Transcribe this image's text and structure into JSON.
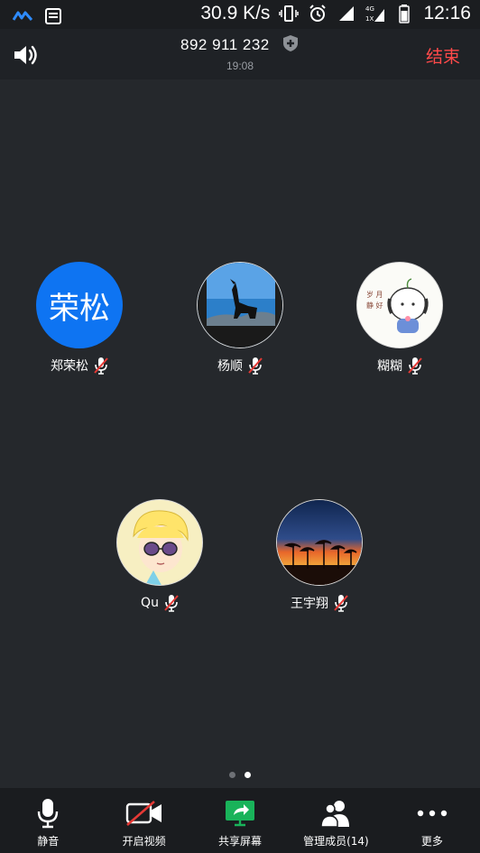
{
  "status_bar": {
    "speed": "30.9 K/s",
    "time": "12:16"
  },
  "header": {
    "meeting_id": "892 911 232",
    "duration": "19:08",
    "end_label": "结束"
  },
  "participants": [
    {
      "name": "郑荣松",
      "avatar_text": "荣松",
      "avatar_color": "#0e74f2",
      "muted": true
    },
    {
      "name": "杨顺",
      "avatar": "photo-dog-silhouette",
      "muted": true
    },
    {
      "name": "糊糊",
      "avatar": "illustration-cartoon",
      "muted": true
    },
    {
      "name": "Qu",
      "avatar": "illustration-anime-boy",
      "muted": true
    },
    {
      "name": "王宇翔",
      "avatar": "photo-sunset-palms",
      "muted": true
    }
  ],
  "pager": {
    "pages": 2,
    "active": 2
  },
  "toolbar": {
    "mute_label": "静音",
    "video_label": "开启视频",
    "share_label": "共享屏幕",
    "members_label": "管理成员(14)",
    "more_label": "更多"
  },
  "colors": {
    "background": "#25282c",
    "end_red": "#ff4a4a",
    "share_green": "#19b35a",
    "mute_red": "#e53935",
    "accent_blue": "#0e74f2"
  }
}
